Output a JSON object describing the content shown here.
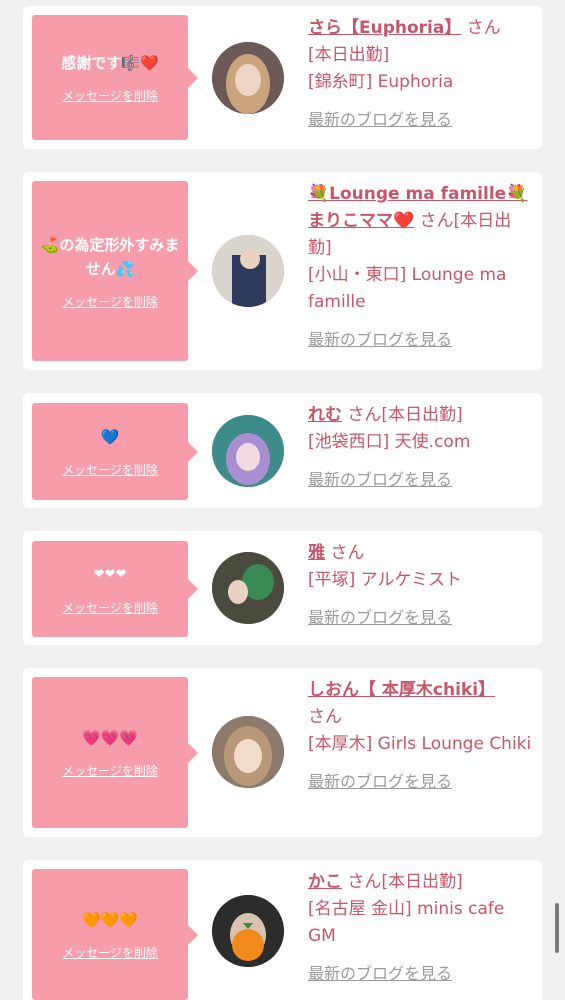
{
  "delete_label": "メッセージを削除",
  "blog_label": "最新のブログを見る",
  "suffix": "さん",
  "entries": [
    {
      "message": "感謝です🎼❤️",
      "name": "さら【Euphoria】",
      "status": "[本日出勤]",
      "shop": "[錦糸町] Euphoria"
    },
    {
      "message": "⛳️の為定形外すみません💦",
      "name": "💐Lounge ma famille💐まりこママ❤️",
      "status": "[本日出勤]",
      "shop": "[小山・東口] Lounge ma famille"
    },
    {
      "message": "💙",
      "name": "れむ",
      "status": "[本日出勤]",
      "shop": "[池袋西口] 天使.com"
    },
    {
      "message": "❤❤❤",
      "name": "雅",
      "status": "",
      "shop": "[平塚] アルケミスト"
    },
    {
      "message": "💗💗💗",
      "name": "しおん【 本厚木chiki】",
      "status": "",
      "shop": "[本厚木] Girls Lounge Chiki"
    },
    {
      "message": "🧡🧡🧡",
      "name": "かこ",
      "status": "[本日出勤]",
      "shop": "[名古屋 金山] minis cafe GM"
    }
  ]
}
